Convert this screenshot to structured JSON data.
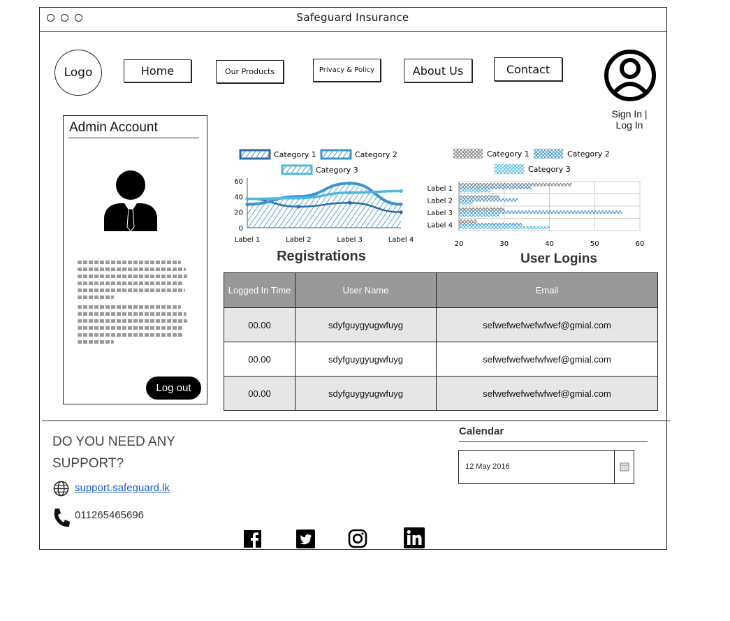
{
  "window": {
    "title": "Safeguard Insurance"
  },
  "header": {
    "logo": "Logo",
    "nav": [
      "Home",
      "Our Products",
      "Privacy & Policy",
      "About Us",
      "Contact"
    ],
    "signin": "Sign In | Log In"
  },
  "admin": {
    "title": "Admin Account",
    "logout": "Log out"
  },
  "charts": {
    "registrations_title": "Registrations",
    "logins_title": "User Logins"
  },
  "chart_data": [
    {
      "type": "area",
      "series": [
        {
          "name": "Category 1",
          "values": [
            37,
            27,
            32,
            20
          ]
        },
        {
          "name": "Category 2",
          "values": [
            30,
            40,
            57,
            30
          ]
        },
        {
          "name": "Category 3",
          "values": [
            37,
            38,
            45,
            47
          ]
        }
      ],
      "categories": [
        "Label 1",
        "Label 2",
        "Label 3",
        "Label 4"
      ],
      "yticks": [
        "0",
        "20",
        "40",
        "60"
      ],
      "ylim": [
        0,
        60
      ],
      "colors": [
        "#2d6a9f",
        "#3d93cf",
        "#4fb8dd"
      ],
      "legend": "top"
    },
    {
      "type": "bar",
      "orientation": "horizontal",
      "series": [
        {
          "name": "Category 1",
          "values": [
            45,
            29,
            30,
            24
          ]
        },
        {
          "name": "Category 2",
          "values": [
            36,
            33,
            56,
            34
          ]
        },
        {
          "name": "Category 3",
          "values": [
            27,
            23,
            29,
            40
          ]
        }
      ],
      "categories": [
        "Label 1",
        "Label 2",
        "Label 3",
        "Label 4"
      ],
      "xticks": [
        "20",
        "30",
        "40",
        "50",
        "60"
      ],
      "xlim": [
        20,
        60
      ],
      "colors": [
        "#777777",
        "#3d93cf",
        "#4fb8dd"
      ],
      "legend": "top"
    }
  ],
  "table": {
    "headers": [
      "Logged In Time",
      "User Name",
      "Email"
    ],
    "rows": [
      [
        "00.00",
        "sdyfguygyugwfuyg",
        "sefwefwefwefwfwef@gmial.com"
      ],
      [
        "00.00",
        "sdyfguygyugwfuyg",
        "sefwefwefwefwfwef@gmial.com"
      ],
      [
        "00.00",
        "sdyfguygyugwfuyg",
        "sefwefwefwefwfwef@gmial.com"
      ]
    ]
  },
  "footer": {
    "support": "DO YOU NEED ANY SUPPORT?",
    "website": "support.safeguard.lk",
    "phone": "011265465696",
    "calendar_title": "Calendar",
    "calendar_value": "12 May 2016",
    "social": [
      "facebook-icon",
      "twitter-icon",
      "instagram-icon",
      "linkedin-icon"
    ]
  }
}
